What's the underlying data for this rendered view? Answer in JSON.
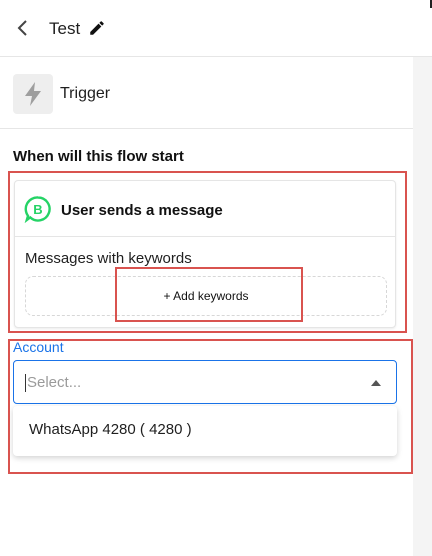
{
  "header": {
    "title": "Test",
    "back_icon": "chevron-left-icon",
    "edit_icon": "pencil-icon"
  },
  "trigger": {
    "label": "Trigger",
    "icon": "lightning-bolt-icon"
  },
  "section": {
    "heading": "When will this flow start"
  },
  "card": {
    "title": "User sends a message",
    "icon": "whatsapp-business-icon",
    "keywords_label": "Messages with keywords",
    "add_keywords_label": "+ Add keywords"
  },
  "account": {
    "label": "Account",
    "placeholder": "Select...",
    "options": [
      "WhatsApp 4280 ( 4280 )"
    ]
  },
  "colors": {
    "accent": "#1a73e8",
    "highlight": "#d9534f",
    "whatsapp": "#25d366"
  }
}
